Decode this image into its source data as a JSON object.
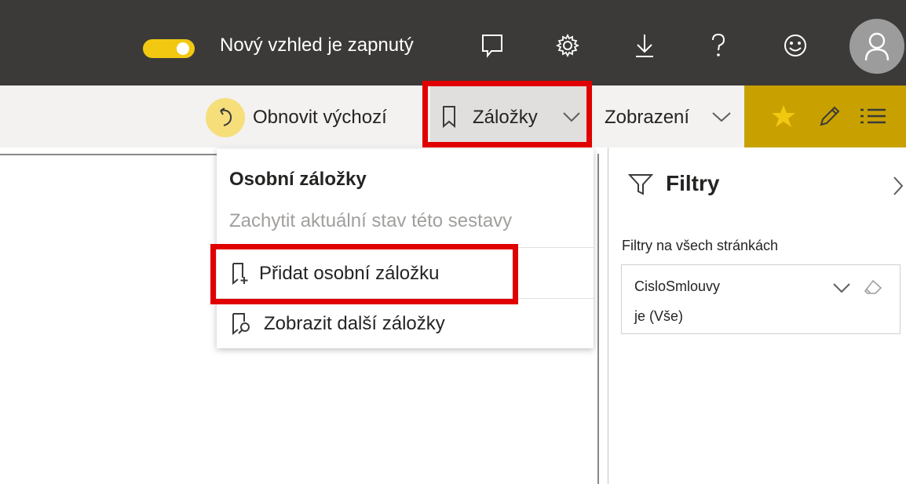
{
  "topbar": {
    "toggle_label": "Nový vzhled je zapnutý",
    "icons": [
      "feedback-icon",
      "settings-icon",
      "download-icon",
      "help-icon",
      "smiley-icon",
      "avatar-icon"
    ]
  },
  "toolbar": {
    "reset_label": "Obnovit výchozí",
    "bookmarks_label": "Záložky",
    "view_label": "Zobrazení",
    "right_icons": [
      "star-icon",
      "pencil-icon",
      "list-icon"
    ]
  },
  "bookmarks_menu": {
    "title": "Osobní záložky",
    "subtitle": "Zachytit aktuální stav této sestavy",
    "add_label": "Přidat osobní záložku",
    "show_more_label": "Zobrazit další záložky"
  },
  "filters": {
    "title": "Filtry",
    "section_label": "Filtry na všech stránkách",
    "card": {
      "field": "CisloSmlouvy",
      "value": "je (Vše)"
    }
  },
  "colors": {
    "topbar_bg": "#3b3a39",
    "accent_yellow": "#f2c811",
    "highlight_red": "#e00000",
    "toolbar_bg": "#f3f2f1"
  }
}
